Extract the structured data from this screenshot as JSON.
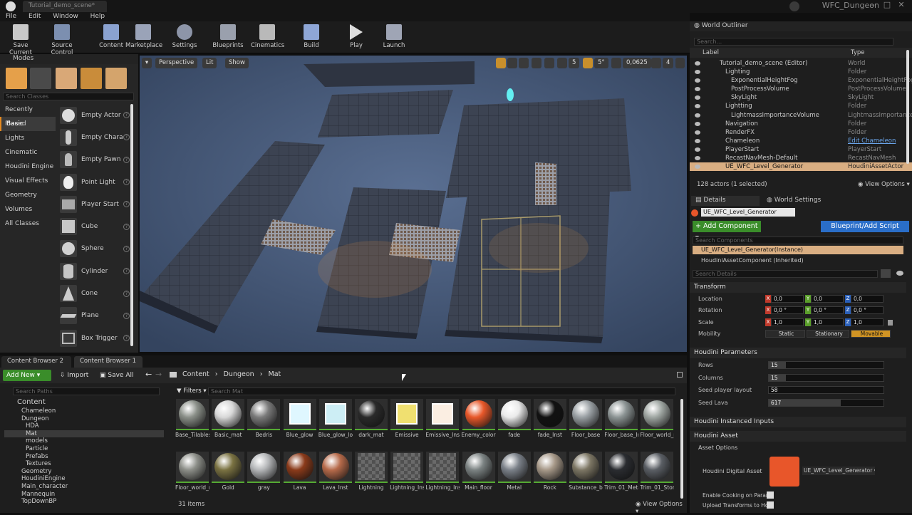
{
  "window": {
    "tab_title": "Tutorial_demo_scene*",
    "project": "WFC_Dungeon"
  },
  "menu": [
    "File",
    "Edit",
    "Window",
    "Help"
  ],
  "toolbar": [
    "Save Current",
    "Source Control",
    "Content",
    "Marketplace",
    "Settings",
    "Blueprints",
    "Cinematics",
    "Build",
    "Play",
    "Launch"
  ],
  "modes": {
    "title": "Modes",
    "search_placeholder": "Search Classes",
    "categories": [
      "Recently Placed",
      "Basic",
      "Lights",
      "Cinematic",
      "Houdini Engine",
      "Visual Effects",
      "Geometry",
      "Volumes",
      "All Classes"
    ],
    "items": [
      "Empty Actor",
      "Empty Chara",
      "Empty Pawn",
      "Point Light",
      "Player Start",
      "Cube",
      "Sphere",
      "Cylinder",
      "Cone",
      "Plane",
      "Box Trigger"
    ]
  },
  "viewport": {
    "perspective": "Perspective",
    "lit": "Lit",
    "show": "Show",
    "grid_snap": "5",
    "rot_snap": "5°",
    "scale_snap": "0,0625",
    "camera_speed": "4"
  },
  "content_browser": {
    "tabs": [
      "Content Browser 2",
      "Content Browser 1"
    ],
    "add_new": "Add New",
    "import": "Import",
    "save_all": "Save All",
    "path": [
      "Content",
      "Dungeon",
      "Mat"
    ],
    "search_paths": "Search Paths",
    "filters": "Filters",
    "search_placeholder": "Search Mat",
    "tree": [
      "Content",
      "Chameleon",
      "Dungeon",
      "HDA",
      "Mat",
      "models",
      "Particle",
      "Prefabs",
      "Textures",
      "Geometry",
      "HoudiniEngine",
      "Main_character",
      "Mannequin",
      "TopDownBP"
    ],
    "assets_row1": [
      "Base_Tilables",
      "Basic_mat",
      "Bedris",
      "Blue_glow",
      "Blue_glow_lower",
      "dark_mat",
      "Emissive",
      "Emissive_Inst",
      "Enemy_color",
      "fade",
      "fade_Inst",
      "Floor_base",
      "Floor_base_Inst",
      "Floor_world_noise"
    ],
    "assets_row2": [
      "Floor_world_noise_Inst",
      "Gold",
      "gray",
      "Lava",
      "Lava_Inst",
      "Lightning",
      "Lightning_Inst",
      "Lightning_Inst_Inst",
      "Main_floor",
      "Metal",
      "Rock",
      "Substance_base",
      "Trim_01_Metal",
      "Trim_01_Stone"
    ],
    "count": "31 items",
    "view_options": "View Options"
  },
  "outliner": {
    "title": "World Outliner",
    "search_placeholder": "Search...",
    "col_label": "Label",
    "col_type": "Type",
    "rows": [
      {
        "label": "Tutorial_demo_scene (Editor)",
        "type": "World"
      },
      {
        "label": "Lighting",
        "type": "Folder"
      },
      {
        "label": "ExponentialHeightFog",
        "type": "ExponentialHeightFog"
      },
      {
        "label": "PostProcessVolume",
        "type": "PostProcessVolume"
      },
      {
        "label": "SkyLight",
        "type": "SkyLight"
      },
      {
        "label": "Lightting",
        "type": "Folder"
      },
      {
        "label": "LightmassImportanceVolume",
        "type": "LightmassImportanceV"
      },
      {
        "label": "Navigation",
        "type": "Folder"
      },
      {
        "label": "RenderFX",
        "type": "Folder"
      },
      {
        "label": "Chameleon",
        "type": "Edit Chameleon"
      },
      {
        "label": "PlayerStart",
        "type": "PlayerStart"
      },
      {
        "label": "RecastNavMesh-Default",
        "type": "RecastNavMesh"
      },
      {
        "label": "UE_WFC_Level_Generator",
        "type": "HoudiniAssetActor"
      }
    ],
    "count": "128 actors (1 selected)",
    "view_options": "View Options"
  },
  "details": {
    "tab1": "Details",
    "tab2": "World Settings",
    "name": "UE_WFC_Level_Generator",
    "add_component": "+ Add Component",
    "blueprint": "Blueprint/Add Script",
    "search_components": "Search Components",
    "instance": "UE_WFC_Level_Generator(Instance)",
    "inherited": "HoudiniAssetComponent (Inherited)",
    "search_details": "Search Details",
    "transform": "Transform",
    "location": {
      "label": "Location",
      "x": "0,0",
      "y": "0,0",
      "z": "0,0"
    },
    "rotation": {
      "label": "Rotation",
      "x": "0,0 °",
      "y": "0,0 °",
      "z": "0,0 °"
    },
    "scale": {
      "label": "Scale",
      "x": "1,0",
      "y": "1,0",
      "z": "1,0"
    },
    "mobility": {
      "label": "Mobility",
      "static": "Static",
      "stationary": "Stationary",
      "movable": "Movable"
    },
    "houdini_params": "Houdini Parameters",
    "rows": {
      "label": "Rows",
      "value": "15",
      "fraction": 0.15
    },
    "columns": {
      "label": "Columns",
      "value": "15",
      "fraction": 0.15
    },
    "seed_player": {
      "label": "Seed player layout",
      "value": "58"
    },
    "seed_lava": {
      "label": "Seed Lava",
      "value": "617",
      "fraction": 0.62
    },
    "instanced_inputs": "Houdini Instanced Inputs",
    "houdini_asset": "Houdini Asset",
    "asset_options": "Asset Options",
    "digital_asset_label": "Houdini Digital Asset",
    "digital_asset_value": "UE_WFC_Level_Generator",
    "enable_cooking": "Enable Cooking on Param",
    "upload_transforms": "Upload Transforms to Ho"
  }
}
